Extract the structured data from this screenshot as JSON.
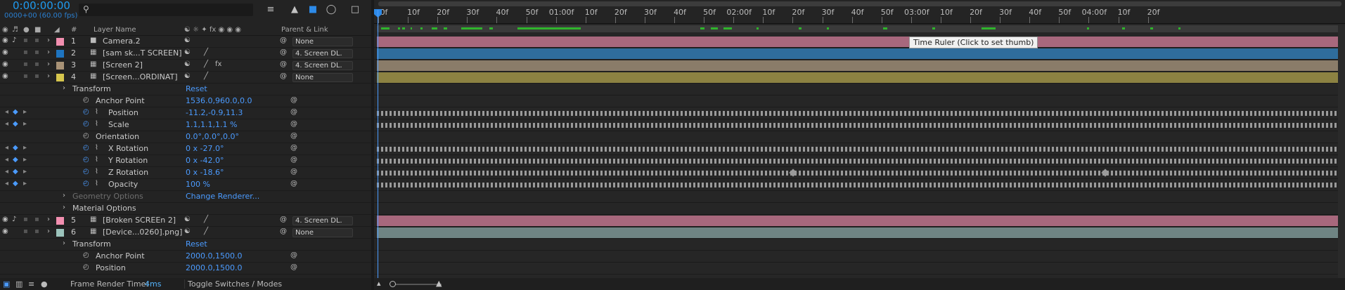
{
  "timecode": "0:00:00:00",
  "fps": "0000+00 (60.00 fps)",
  "search_placeholder": "",
  "headers": {
    "layer_name": "Layer Name",
    "parent": "Parent & Link",
    "num": "#"
  },
  "layers": [
    {
      "num": "1",
      "name": "Camera.2",
      "color": "#f28fb0",
      "parent": "None",
      "type": "camera"
    },
    {
      "num": "2",
      "name": "[sam sk...T SCREEN]",
      "color": "#1e74c0",
      "parent": "4. Screen DL.",
      "type": "comp"
    },
    {
      "num": "3",
      "name": "[Screen 2]",
      "color": "#a89276",
      "parent": "4. Screen DL.",
      "type": "comp"
    },
    {
      "num": "4",
      "name": "[Screen...ORDINAT]",
      "color": "#d6c64d",
      "parent": "None",
      "type": "comp"
    }
  ],
  "transform_label": "Transform",
  "reset": "Reset",
  "props": [
    {
      "name": "Anchor Point",
      "value": "1536.0,960.0,0.0",
      "kf": false
    },
    {
      "name": "Position",
      "value": "-11.2,-0.9,11.3",
      "kf": true
    },
    {
      "name": "Scale",
      "value": "1.1,1.1,1.1 %",
      "kf": true
    },
    {
      "name": "Orientation",
      "value": "0.0°,0.0°,0.0°",
      "kf": false
    },
    {
      "name": "X Rotation",
      "value": "0 x -27.0°",
      "kf": true
    },
    {
      "name": "Y Rotation",
      "value": "0 x -42.0°",
      "kf": true
    },
    {
      "name": "Z Rotation",
      "value": "0 x -18.6°",
      "kf": true
    },
    {
      "name": "Opacity",
      "value": "100 %",
      "kf": true
    }
  ],
  "geometry_options": "Geometry Options",
  "change_renderer": "Change Renderer...",
  "material_options": "Material Options",
  "layers2": [
    {
      "num": "5",
      "name": "[Broken SCREEn 2]",
      "color": "#f28fb0",
      "parent": "4. Screen DL."
    },
    {
      "num": "6",
      "name": "[Device...0260].png]",
      "color": "#9cc4bc",
      "parent": "None"
    }
  ],
  "props2": [
    {
      "name": "Anchor Point",
      "value": "2000.0,1500.0"
    },
    {
      "name": "Position",
      "value": "2000.0,1500.0"
    }
  ],
  "footer": {
    "render_label": "Frame Render Time:",
    "render_value": "4ms",
    "toggle": "Toggle Switches / Modes"
  },
  "ruler_ticks": [
    "0f",
    "10f",
    "20f",
    "30f",
    "40f",
    "50f",
    "01:00f",
    "10f",
    "20f",
    "30f",
    "40f",
    "50f",
    "02:00f",
    "10f",
    "20f",
    "30f",
    "40f",
    "50f",
    "03:00f",
    "10f",
    "20f",
    "30f",
    "40f",
    "50f",
    "04:00f",
    "10f",
    "20f"
  ],
  "tooltip": "Time Ruler (Click to set thumb)",
  "bar_colors": {
    "1": "#a8687d",
    "2": "#2f6d9c",
    "3": "#8a7c69",
    "4": "#8c8242",
    "5": "#a8687d",
    "6": "#6f8483"
  }
}
